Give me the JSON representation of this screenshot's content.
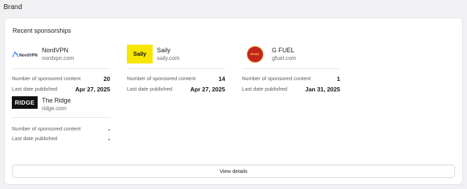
{
  "section_title": "Brand",
  "card_title": "Recent sponsorships",
  "brands": [
    {
      "name": "NordVPN",
      "domain": "nordvpn.com",
      "logo_text": "NordVPN",
      "count_label": "Number of sponsored content",
      "count": "20",
      "date_label": "Last date published",
      "date": "Apr 27, 2025"
    },
    {
      "name": "Saily",
      "domain": "saily.com",
      "logo_text": "Saily",
      "count_label": "Number of sponsored content",
      "count": "14",
      "date_label": "Last date published",
      "date": "Apr 27, 2025"
    },
    {
      "name": "G FUEL",
      "domain": "gfuel.com",
      "logo_text": "GFUEL",
      "count_label": "Number of sponsored content",
      "count": "1",
      "date_label": "Last date published",
      "date": "Jan 31, 2025"
    },
    {
      "name": "The Ridge",
      "domain": "ridge.com",
      "logo_text": "RIDGE",
      "count_label": "Number of sponsored content",
      "count": "-",
      "date_label": "Last date published",
      "date": "-"
    }
  ],
  "view_details_label": "View details",
  "colors": {
    "saily": "#f7e600",
    "gfuel": "#c2251c",
    "ridge": "#111111"
  }
}
